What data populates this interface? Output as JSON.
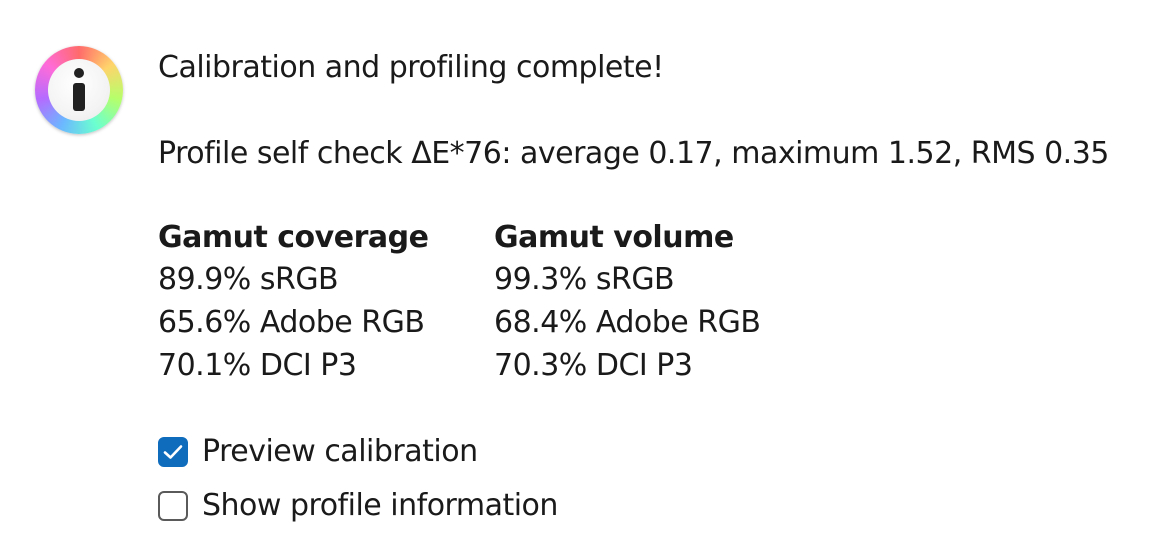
{
  "dialog": {
    "icon": "info-icon",
    "title": "Calibration and profiling complete!",
    "self_check": "Profile self check ΔE*76: average 0.17, maximum 1.52, RMS 0.35",
    "gamut": {
      "coverage": {
        "header": "Gamut coverage",
        "rows": [
          "89.9% sRGB",
          "65.6% Adobe RGB",
          "70.1% DCI P3"
        ]
      },
      "volume": {
        "header": "Gamut volume",
        "rows": [
          "99.3% sRGB",
          "68.4% Adobe RGB",
          "70.3% DCI P3"
        ]
      }
    },
    "options": [
      {
        "label": "Preview calibration",
        "checked": true
      },
      {
        "label": "Show profile information",
        "checked": false
      }
    ],
    "colors": {
      "checkbox_accent": "#0f6cbd",
      "text": "#1a1a1a"
    }
  }
}
